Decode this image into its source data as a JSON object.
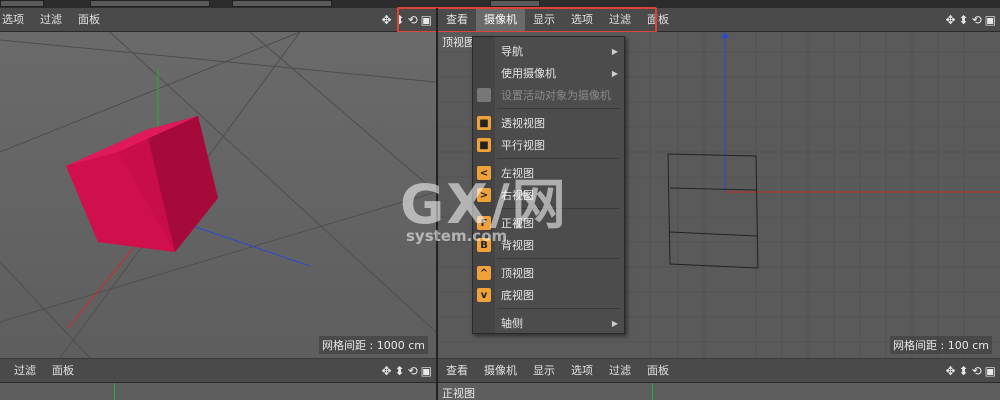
{
  "left_viewport": {
    "menu": [
      "选项",
      "过滤",
      "面板"
    ]
  },
  "right_viewport": {
    "menu": [
      "查看",
      "摄像机",
      "显示",
      "选项",
      "过滤",
      "面板"
    ],
    "active_menu": "摄像机",
    "view_label": "顶视图",
    "grid_info": "网格间距 : 100 cm"
  },
  "left_grid_info": "网格间距 : 1000 cm",
  "camera_menu": {
    "items": [
      {
        "label": "导航",
        "icon": "none",
        "submenu": true,
        "enabled": true
      },
      {
        "label": "使用摄像机",
        "icon": "none",
        "submenu": true,
        "enabled": true
      },
      {
        "label": "设置活动对象为摄像机",
        "icon": "camera-ghost-icon",
        "submenu": false,
        "enabled": false
      },
      {
        "label": "透视视图",
        "icon": "cube-icon",
        "submenu": false,
        "enabled": true
      },
      {
        "label": "平行视图",
        "icon": "cube-icon",
        "submenu": false,
        "enabled": true
      },
      {
        "label": "左视图",
        "icon": "arrow-left-icon",
        "glyph": "<",
        "submenu": false,
        "enabled": true
      },
      {
        "label": "右视图",
        "icon": "arrow-right-icon",
        "glyph": ">",
        "submenu": false,
        "enabled": true
      },
      {
        "label": "正视图",
        "icon": "front-F-icon",
        "glyph": "F",
        "submenu": false,
        "enabled": true
      },
      {
        "label": "背视图",
        "icon": "back-B-icon",
        "glyph": "B",
        "submenu": false,
        "enabled": true
      },
      {
        "label": "顶视图",
        "icon": "arrow-up-icon",
        "glyph": "^",
        "submenu": false,
        "enabled": true
      },
      {
        "label": "底视图",
        "icon": "arrow-down-icon",
        "glyph": "v",
        "submenu": false,
        "enabled": true
      },
      {
        "label": "轴侧",
        "icon": "none",
        "submenu": true,
        "enabled": true
      }
    ]
  },
  "bottom_left": {
    "menu": [
      "过滤",
      "面板"
    ]
  },
  "bottom_right": {
    "menu": [
      "查看",
      "摄像机",
      "显示",
      "选项",
      "过滤",
      "面板"
    ],
    "view_label": "正视图"
  },
  "watermark": {
    "brand": "GX/网",
    "domain": "system.com"
  },
  "colors": {
    "cube": "#d0104c",
    "highlight": "#e0413a",
    "icon_orange": "#f0a13a",
    "axis_x": "#d02a2a",
    "axis_y": "#2ab02a",
    "axis_z": "#2a4ad0"
  }
}
